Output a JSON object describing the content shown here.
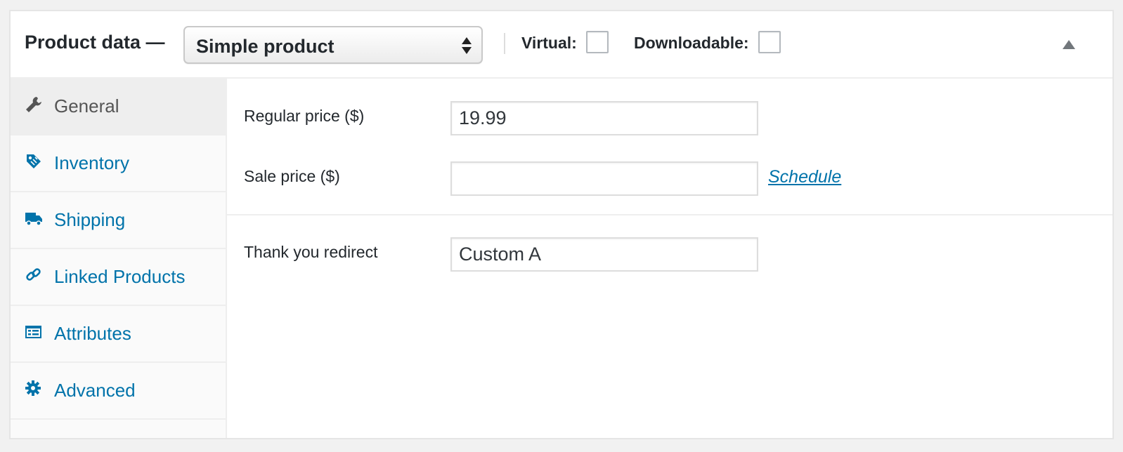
{
  "header": {
    "title": "Product data —",
    "product_type": {
      "selected": "Simple product"
    },
    "virtual_label": "Virtual:",
    "virtual_checked": false,
    "downloadable_label": "Downloadable:",
    "downloadable_checked": false,
    "collapse_icon": "triangle-up-icon"
  },
  "tabs": [
    {
      "label": "General",
      "icon": "wrench-icon",
      "active": true
    },
    {
      "label": "Inventory",
      "icon": "tag-icon",
      "active": false
    },
    {
      "label": "Shipping",
      "icon": "truck-icon",
      "active": false
    },
    {
      "label": "Linked Products",
      "icon": "link-icon",
      "active": false
    },
    {
      "label": "Attributes",
      "icon": "list-card-icon",
      "active": false
    },
    {
      "label": "Advanced",
      "icon": "gear-icon",
      "active": false
    }
  ],
  "general": {
    "regular_price_label": "Regular price ($)",
    "regular_price_value": "19.99",
    "sale_price_label": "Sale price ($)",
    "sale_price_value": "",
    "schedule_link": "Schedule",
    "thank_you_label": "Thank you redirect",
    "thank_you_value": "Custom A"
  },
  "colors": {
    "link_blue": "#0073aa",
    "text_dark": "#23282d",
    "active_tab_bg": "#eeeeee",
    "border": "#dddddd"
  }
}
